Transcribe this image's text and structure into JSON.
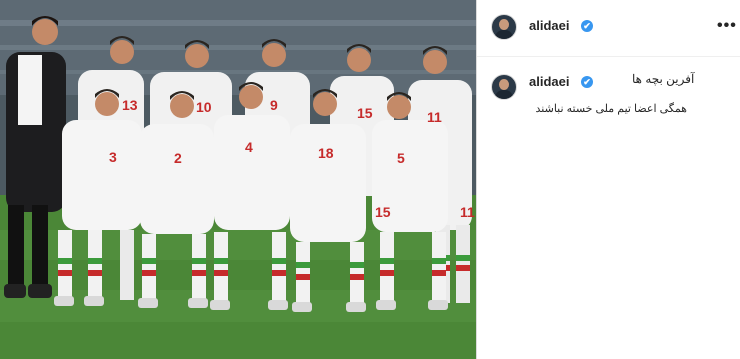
{
  "post": {
    "username": "alidaei",
    "verified_badge": "✔",
    "more_icon": "•••",
    "caption_line1": "آفرین بچه ها",
    "caption_line2": "همگی اعضا تیم ملی خسته نباشند"
  },
  "photo": {
    "jersey_numbers": [
      "13",
      "10",
      "9",
      "15",
      "11",
      "3",
      "2",
      "4",
      "18",
      "5",
      "15",
      "11"
    ]
  }
}
